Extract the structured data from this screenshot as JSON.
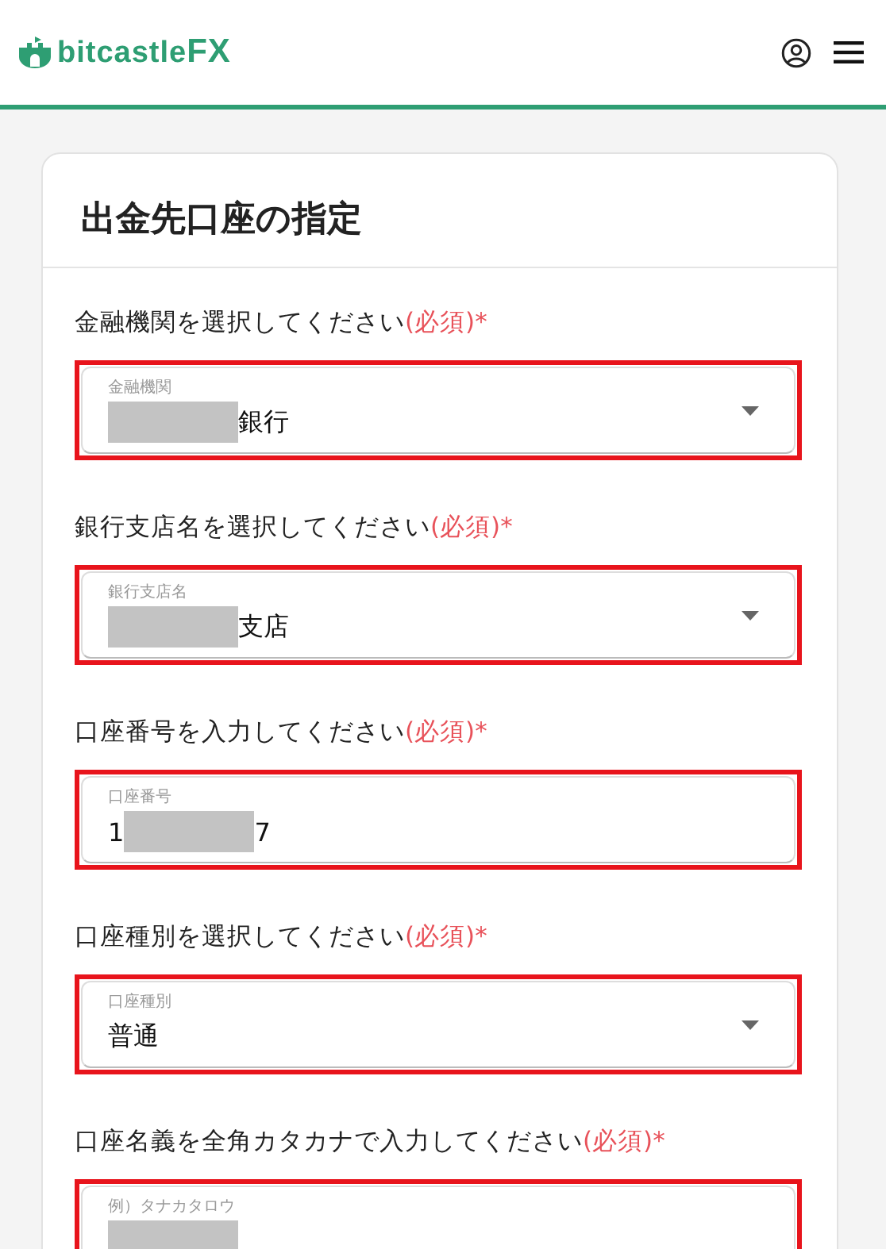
{
  "header": {
    "logo": {
      "brand": "bitcastle",
      "suffix": "FX"
    }
  },
  "card": {
    "title": "出金先口座の指定"
  },
  "fields": [
    {
      "kind": "select",
      "label": "金融機関を選択してください",
      "required_mark": "(必須)*",
      "highlighted": true,
      "floating_label": "金融機関",
      "redacted": true,
      "value_end": "銀行"
    },
    {
      "kind": "select",
      "label": "銀行支店名を選択してください",
      "required_mark": "(必須)*",
      "highlighted": true,
      "floating_label": "銀行支店名",
      "redacted": true,
      "value_end": "支店"
    },
    {
      "kind": "text",
      "label": "口座番号を入力してください",
      "required_mark": "(必須)*",
      "highlighted": true,
      "floating_label": "口座番号",
      "redacted": true,
      "value_start": "1",
      "value_end": "7"
    },
    {
      "kind": "select",
      "label": "口座種別を選択してください",
      "required_mark": "(必須)*",
      "highlighted": true,
      "floating_label": "口座種別",
      "redacted": false,
      "value_start": "普通"
    },
    {
      "kind": "text",
      "label": "口座名義を全角カタカナで入力してください",
      "required_mark": "(必須)*",
      "highlighted": true,
      "floating_label": "例）タナカタロウ",
      "redacted": true
    }
  ]
}
